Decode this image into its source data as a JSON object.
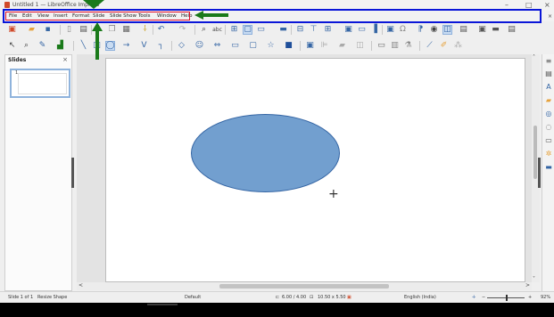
{
  "window": {
    "title": "Untitled 1 — LibreOffice Impress",
    "minimize_glyph": "–",
    "maximize_glyph": "□",
    "close_glyph": "×"
  },
  "menu": {
    "items": [
      "File",
      "Edit",
      "View",
      "Insert",
      "Format",
      "Slide",
      "Slide Show",
      "Tools",
      "Window",
      "Help"
    ],
    "close_doc_glyph": "×"
  },
  "slides_pane": {
    "title": "Slides",
    "close_glyph": "×",
    "thumbnail_number": "1"
  },
  "statusbar": {
    "slide_info": "Slide 1 of 1",
    "shape_info": "Resize Shape",
    "master": "Default",
    "position": "6.00 / 4.00",
    "size": "10.50 x 5.50",
    "language": "English (India)",
    "zoom_minus": "−",
    "zoom_plus": "+",
    "zoom": "92%"
  },
  "scroll": {
    "up": "˄",
    "down": "˅",
    "left": "<",
    "right": ">"
  },
  "colors": {
    "annotation_blue": "#0a16d8",
    "annotation_red": "#e0102a",
    "annotation_green": "#1a7a1a",
    "shape_fill": "#729fcf",
    "shape_border": "#3465a4"
  },
  "toolbar_icons": {
    "row1": [
      "new-icon",
      "open-icon",
      "save-icon",
      "export-pdf-icon",
      "print-icon",
      "copy-icon",
      "paste-icon",
      "clone-icon",
      "undo-icon",
      "redo-icon",
      "find-replace-icon",
      "spelling-icon",
      "grid-icon",
      "display-views-icon",
      "master-slide-icon",
      "start-slideshow-icon",
      "slide-icon",
      "table-icon",
      "image-icon",
      "media-icon",
      "chart-icon",
      "textbox-icon",
      "special-char-icon",
      "fontwork-icon",
      "transform-icon",
      "show-draw-icon",
      "slide-layout-icon",
      "more-icon"
    ],
    "row2": [
      "select-icon",
      "zoom-icon",
      "line-color-icon",
      "fill-color-icon",
      "line-icon",
      "rectangle-icon",
      "ellipse-icon",
      "arrow-icon",
      "curve-icon",
      "connector-icon",
      "basic-shapes-icon",
      "symbol-shapes-icon",
      "block-arrows-icon",
      "flowchart-icon",
      "callouts-icon",
      "stars-icon",
      "3d-objects-icon",
      "rotate-icon",
      "align-icon",
      "arrange-icon",
      "distribute-icon",
      "shadow-icon",
      "crop-icon",
      "filter-icon",
      "points-icon",
      "glue-icon",
      "toggle-extrusion-icon"
    ]
  },
  "sidebar_icons": [
    "properties-icon",
    "styles-icon",
    "gallery-icon",
    "navigator-icon",
    "animation-icon",
    "slide-transition-icon",
    "master-slides-icon",
    "shapes-icon"
  ]
}
